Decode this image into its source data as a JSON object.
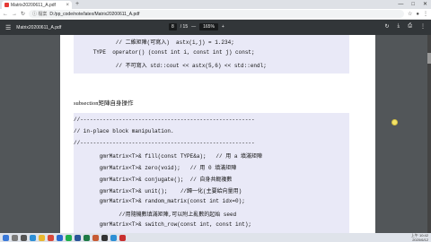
{
  "browser": {
    "tab_title": "Matrix20200611_A.pdf",
    "tab_close": "×",
    "new_tab": "+",
    "window_controls": [
      "—",
      "□",
      "✕"
    ],
    "address_info": "ⓘ 檔案",
    "address_path": "D:/pp_code/note/latex/Matrix20200611_A.pdf"
  },
  "pdf_toolbar": {
    "menu_icon": "☰",
    "filename": "Matrix20200611_A.pdf",
    "page_current": "8",
    "page_total": "/ 15",
    "zoom_minus": "—",
    "zoom": "165%",
    "zoom_plus": "+",
    "right_icons": [
      "↻",
      "⤓",
      "⎙",
      "⋮"
    ]
  },
  "page": {
    "code_block_1": [
      "             // 二維矩陣(可寫入)  astx(i,j) = 1.234;",
      "      TYPE  operator() (const int i, const int j) const;",
      "             // 不可寫入 std::cout << astx(5,6) << std::endl;"
    ],
    "subsection": "subsection矩陣自身操作",
    "code_block_2": [
      "//------------------------------------------------------",
      "// in-place block manipulation.",
      "//------------------------------------------------------",
      "        gmrMatrix<T>& fill(const TYPE&a);   // 用 a 填滿矩陣",
      "        gmrMatrix<T>& zero(void);   // 用 0 填滿矩陣",
      "        gmrMatrix<T>& conjugate();  // 自身共軛複數",
      "        gmrMatrix<T>& unit();    //歸一化(主要給向量用)",
      "        gmrMatrix<T>& random_matrix(const int idx=0);",
      "              //用隨機數填滿矩陣,可以附上亂數的起始 seed",
      "        gmrMatrix<T>& switch_row(const int, const int);"
    ]
  },
  "taskbar": {
    "apps": [
      {
        "name": "start",
        "color": "#3a78d8"
      },
      {
        "name": "search",
        "color": "#7a7a7a"
      },
      {
        "name": "taskview",
        "color": "#555555"
      },
      {
        "name": "edge",
        "color": "#2e8fd6"
      },
      {
        "name": "explorer",
        "color": "#e8b730"
      },
      {
        "name": "chrome",
        "color": "#d9483b"
      },
      {
        "name": "store",
        "color": "#2b6cd1"
      },
      {
        "name": "line",
        "color": "#21b04b"
      },
      {
        "name": "word",
        "color": "#2a5599"
      },
      {
        "name": "excel",
        "color": "#1e7a45"
      },
      {
        "name": "ppt",
        "color": "#c75b34"
      },
      {
        "name": "terminal",
        "color": "#333333"
      },
      {
        "name": "vscode",
        "color": "#2d8fd5"
      },
      {
        "name": "pdf",
        "color": "#c83030"
      }
    ],
    "time": "上午 10:42",
    "date": "2020/6/12"
  }
}
